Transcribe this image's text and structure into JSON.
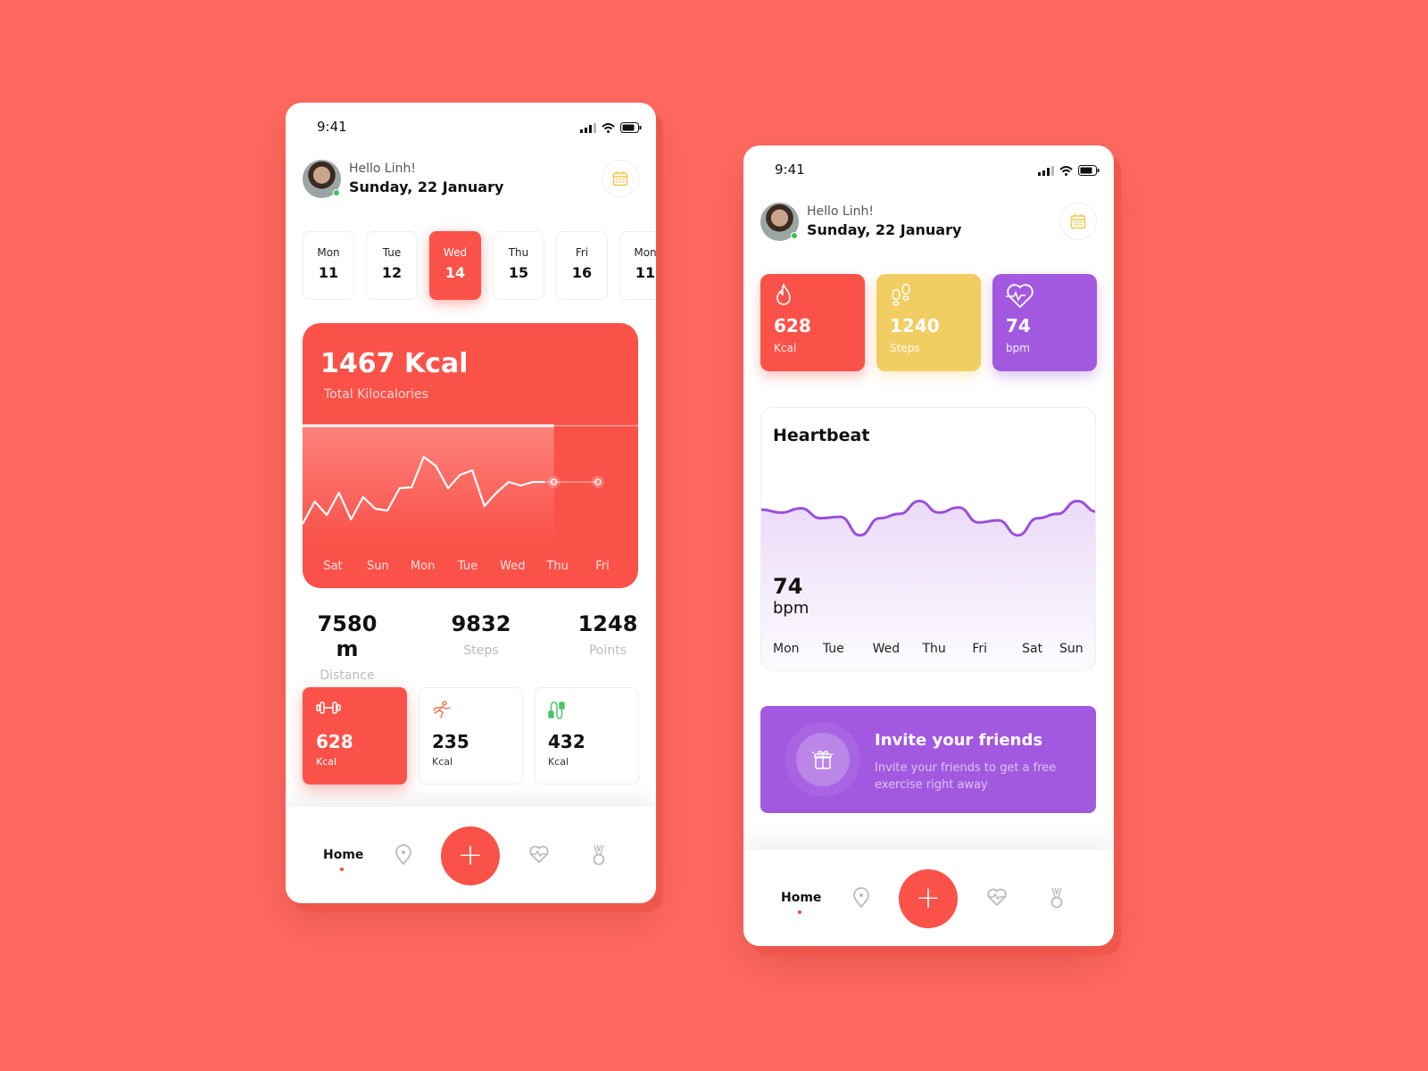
{
  "colors": {
    "background": "#ff6a60",
    "accent": "#fa5249",
    "yellow": "#f2cd62",
    "purple": "#a259e0",
    "online": "#37c45b"
  },
  "status_bar": {
    "time": "9:41"
  },
  "header": {
    "greeting": "Hello Linh!",
    "date": "Sunday, 22 January"
  },
  "phone1": {
    "days": [
      {
        "name": "Mon",
        "num": "11",
        "active": false
      },
      {
        "name": "Tue",
        "num": "12",
        "active": false
      },
      {
        "name": "Wed",
        "num": "14",
        "active": true
      },
      {
        "name": "Thu",
        "num": "15",
        "active": false
      },
      {
        "name": "Fri",
        "num": "16",
        "active": false
      },
      {
        "name": "Mon",
        "num": "11",
        "active": false
      }
    ],
    "kcal_card": {
      "value": "1467 Kcal",
      "label": "Total Kilocalories"
    },
    "stats": [
      {
        "value": "7580 m",
        "label": "Distance"
      },
      {
        "value": "9832",
        "label": "Steps"
      },
      {
        "value": "1248",
        "label": "Points"
      }
    ],
    "activities": [
      {
        "icon": "dumbbell-icon",
        "value": "628",
        "unit": "Kcal",
        "active": true
      },
      {
        "icon": "running-icon",
        "value": "235",
        "unit": "Kcal",
        "active": false
      },
      {
        "icon": "jump-rope-icon",
        "value": "432",
        "unit": "Kcal",
        "active": false
      }
    ]
  },
  "phone2": {
    "tiles": [
      {
        "icon": "flame-icon",
        "value": "628",
        "unit": "Kcal",
        "color": "#fa5249"
      },
      {
        "icon": "footsteps-icon",
        "value": "1240",
        "unit": "Steps",
        "color": "#f2cd62"
      },
      {
        "icon": "heart-pulse-icon",
        "value": "74",
        "unit": "bpm",
        "color": "#a259e0"
      }
    ],
    "heartbeat": {
      "title": "Heartbeat",
      "value": "74",
      "unit": "bpm"
    },
    "invite": {
      "title": "Invite your friends",
      "description": "Invite your friends to get a free exercise right away"
    }
  },
  "nav": {
    "home_label": "Home"
  },
  "chart_data": [
    {
      "type": "line",
      "title": "Total Kilocalories",
      "categories": [
        "Sat",
        "Sun",
        "Mon",
        "Tue",
        "Wed",
        "Thu",
        "Fri"
      ],
      "values": [
        0.15,
        0.4,
        0.25,
        0.5,
        0.2,
        0.45,
        0.32,
        0.3,
        0.55,
        0.56,
        0.9,
        0.8,
        0.55,
        0.7,
        0.75,
        0.35,
        0.5,
        0.62,
        0.58,
        0.62,
        0.62
      ],
      "highlight_until": "Thu",
      "ylim": [
        0,
        1
      ]
    },
    {
      "type": "area",
      "title": "Heartbeat",
      "categories": [
        "Mon",
        "Tue",
        "Wed",
        "Thu",
        "Fri",
        "Sat",
        "Sun"
      ],
      "values": [
        0.75,
        0.68,
        0.78,
        0.55,
        0.58,
        0.15,
        0.55,
        0.65,
        0.95,
        0.68,
        0.8,
        0.45,
        0.5,
        0.15,
        0.55,
        0.65,
        0.95,
        0.7
      ],
      "current_value": 74,
      "unit": "bpm"
    }
  ]
}
